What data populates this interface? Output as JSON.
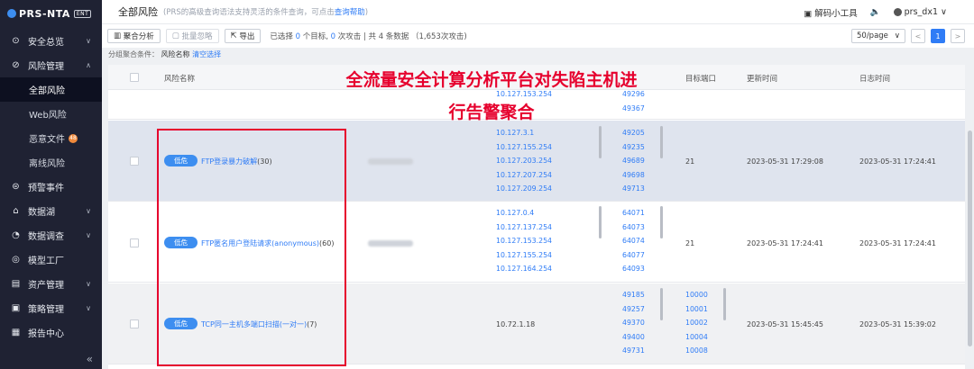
{
  "app": {
    "logo": "PRS-NTA",
    "edition": "ENT"
  },
  "sidebar": {
    "items": [
      {
        "label": "安全总览",
        "icon": "compass-icon",
        "chevron": "∨"
      },
      {
        "label": "风险管理",
        "icon": "risk-icon",
        "chevron": "∧"
      },
      {
        "label": "全部风险",
        "sub": true,
        "active": true
      },
      {
        "label": "Web风险",
        "sub": true
      },
      {
        "label": "恶意文件",
        "sub": true,
        "badge": "48"
      },
      {
        "label": "离线风险",
        "sub": true
      },
      {
        "label": "预警事件",
        "icon": "alert-icon"
      },
      {
        "label": "数据湖",
        "icon": "home-icon",
        "chevron": "∨"
      },
      {
        "label": "数据调查",
        "icon": "chart-icon",
        "chevron": "∨"
      },
      {
        "label": "模型工厂",
        "icon": "model-icon"
      },
      {
        "label": "资产管理",
        "icon": "asset-icon",
        "chevron": "∨"
      },
      {
        "label": "策略管理",
        "icon": "policy-icon",
        "chevron": "∨"
      },
      {
        "label": "报告中心",
        "icon": "calendar-icon"
      }
    ],
    "collapse": "«"
  },
  "header": {
    "title": "全部风险",
    "hint_prefix": "(PRS的高级查询语法支持灵活的条件查询，可点击",
    "hint_link": "查询帮助",
    "hint_suffix": ")",
    "tool_label": "解码小工具",
    "user": "prs_dx1"
  },
  "toolbar": {
    "aggregate": "聚合分析",
    "batch": "批量忽略",
    "export": "导出",
    "sel_prefix": "已选择",
    "sel_targets": "0",
    "sel_mid1": "个目标,",
    "sel_attacks": "0",
    "sel_mid2": "次攻击 | 共 4 条数据 （1,653次攻击)",
    "page_size": "50/page",
    "page": "1"
  },
  "filter": {
    "label": "分组聚合条件：",
    "key": "风险名称",
    "clear": "清空选择"
  },
  "table": {
    "headers": [
      "风险名称",
      "目标端口",
      "更新时间",
      "日志时间"
    ],
    "rows": [
      {
        "ips": [
          "10.127.153.254"
        ],
        "ports": [
          "49296",
          "49367"
        ]
      },
      {
        "level": "低危",
        "name": "FTP登录暴力破解",
        "count": "(30)",
        "ips": [
          "10.127.3.1",
          "10.127.155.254",
          "10.127.203.254",
          "10.127.207.254",
          "10.127.209.254"
        ],
        "ports": [
          "49205",
          "49235",
          "49689",
          "49698",
          "49713"
        ],
        "target_port": "21",
        "update": "2023-05-31 17:29:08",
        "log": "2023-05-31 17:24:41"
      },
      {
        "level": "低危",
        "name": "FTP匿名用户登陆请求(anonymous)",
        "count": "(60)",
        "ips": [
          "10.127.0.4",
          "10.127.137.254",
          "10.127.153.254",
          "10.127.155.254",
          "10.127.164.254"
        ],
        "ports": [
          "64071",
          "64073",
          "64074",
          "64077",
          "64093"
        ],
        "target_port": "21",
        "update": "2023-05-31 17:24:41",
        "log": "2023-05-31 17:24:41"
      },
      {
        "level": "低危",
        "name": "TCP同一主机多端口扫描(一对一)",
        "count": "(7)",
        "ips": [
          "10.72.1.18"
        ],
        "ports": [
          "49185",
          "49257",
          "49370",
          "49400",
          "49731"
        ],
        "target_ports": [
          "10000",
          "10001",
          "10002",
          "10004",
          "10008"
        ],
        "update": "2023-05-31 15:45:45",
        "log": "2023-05-31 15:39:02"
      }
    ]
  },
  "overlay": {
    "line1": "全流量安全计算分析平台对失陷主机进",
    "line2": "行告警聚合"
  }
}
